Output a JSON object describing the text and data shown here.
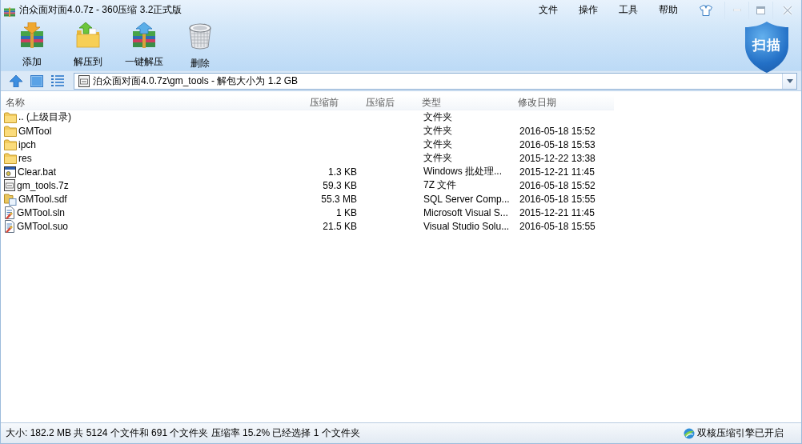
{
  "window": {
    "title": "泊众面对面4.0.7z - 360压缩 3.2正式版"
  },
  "menu": [
    "文件",
    "操作",
    "工具",
    "帮助"
  ],
  "toolbar": [
    {
      "label": "添加",
      "kind": "add"
    },
    {
      "label": "解压到",
      "kind": "extract_to"
    },
    {
      "label": "一键解压",
      "kind": "quick_extract"
    },
    {
      "label": "删除",
      "kind": "delete"
    }
  ],
  "scan_button": {
    "label": "扫描"
  },
  "address_bar": {
    "value": "泊众面对面4.0.7z\\gm_tools - 解包大小为 1.2 GB"
  },
  "table": {
    "columns": [
      "名称",
      "压缩前",
      "压缩后",
      "类型",
      "修改日期"
    ],
    "rows": [
      {
        "kind": "folder",
        "name": ".. (上级目录)",
        "type": "文件夹"
      },
      {
        "kind": "folder",
        "name": "GMTool",
        "type": "文件夹",
        "modified": "2016-05-18 15:52"
      },
      {
        "kind": "folder",
        "name": "ipch",
        "type": "文件夹",
        "modified": "2016-05-18 15:53"
      },
      {
        "kind": "folder",
        "name": "res",
        "type": "文件夹",
        "modified": "2015-12-22 13:38"
      },
      {
        "kind": "batch",
        "name": "Clear.bat",
        "size": "1.3 KB",
        "type": "Windows 批处理...",
        "modified": "2015-12-21 11:45"
      },
      {
        "kind": "archive",
        "name": "gm_tools.7z",
        "size": "59.3 KB",
        "type": "7Z 文件",
        "modified": "2016-05-18 15:52"
      },
      {
        "kind": "database",
        "name": "GMTool.sdf",
        "size": "55.3 MB",
        "type": "SQL Server Comp...",
        "modified": "2016-05-18 15:55"
      },
      {
        "kind": "solution",
        "name": "GMTool.sln",
        "size": "1 KB",
        "type": "Microsoft Visual S...",
        "modified": "2015-12-21 11:45"
      },
      {
        "kind": "solution",
        "name": "GMTool.suo",
        "size": "21.5 KB",
        "type": "Visual Studio Solu...",
        "modified": "2016-05-18 15:55"
      }
    ]
  },
  "status_bar": {
    "summary": "大小: 182.2 MB 共 5124 个文件和 691 个文件夹 压缩率 15.2% 已经选择 1 个文件夹",
    "engine": "双核压缩引擎已开启"
  }
}
